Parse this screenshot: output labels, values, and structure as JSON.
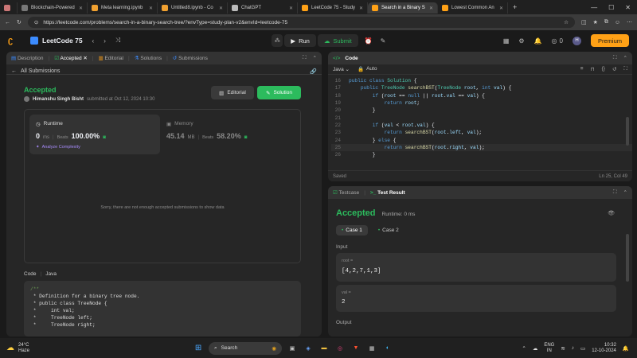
{
  "browser": {
    "tabs": [
      {
        "label": "Blockchain-Powered"
      },
      {
        "label": "Meta learning.ipynb"
      },
      {
        "label": "Untitled8.ipynb - Co"
      },
      {
        "label": "ChatGPT"
      },
      {
        "label": "LeetCode 75 - Study"
      },
      {
        "label": "Search in a Binary S"
      },
      {
        "label": "Lowest Common An"
      }
    ],
    "url": "https://leetcode.com/problems/search-in-a-binary-search-tree/?envType=study-plan-v2&envId=leetcode-75"
  },
  "topbar": {
    "title": "LeetCode 75",
    "run_label": "Run",
    "submit_label": "Submit",
    "coins": "0",
    "avatar": "H",
    "premium_label": "Premium"
  },
  "left": {
    "tabs": [
      "Description",
      "Accepted",
      "Editorial",
      "Solutions",
      "Submissions"
    ],
    "back_label": "All Submissions",
    "status": "Accepted",
    "user": "Himanshu Singh Bisht",
    "submitted_text": "submitted at Oct 12, 2024 10:30",
    "editorial_btn": "Editorial",
    "solution_btn": "Solution",
    "runtime": {
      "label": "Runtime",
      "value": "0",
      "unit": "ms",
      "beats_label": "Beats",
      "beats": "100.00%",
      "analyze": "Analyze Complexity"
    },
    "memory": {
      "label": "Memory",
      "value": "45.14",
      "unit": "MB",
      "beats_label": "Beats",
      "beats": "58.20%"
    },
    "empty_msg": "Sorry, there are not enough accepted submissions to show data",
    "code_label": "Code",
    "code_lang": "Java",
    "code_lines": [
      "/**",
      " * Definition for a binary tree node.",
      " * public class TreeNode {",
      " *     int val;",
      " *     TreeNode left;",
      " *     TreeNode right;"
    ]
  },
  "editor": {
    "title": "Code",
    "lang": "Java",
    "mode": "Auto",
    "lines": [
      {
        "n": "16",
        "t": "public class Solution {"
      },
      {
        "n": "17",
        "t": "    public TreeNode searchBST(TreeNode root, int val) {"
      },
      {
        "n": "18",
        "t": "        if (root == null || root.val == val) {"
      },
      {
        "n": "19",
        "t": "            return root;"
      },
      {
        "n": "20",
        "t": "        }"
      },
      {
        "n": "21",
        "t": ""
      },
      {
        "n": "22",
        "t": "        if (val < root.val) {"
      },
      {
        "n": "23",
        "t": "            return searchBST(root.left, val);"
      },
      {
        "n": "24",
        "t": "        } else {"
      },
      {
        "n": "25",
        "t": "            return searchBST(root.right, val);"
      },
      {
        "n": "26",
        "t": "        }"
      }
    ],
    "saved": "Saved",
    "cursor": "Ln 25, Col 49"
  },
  "testpanel": {
    "tab_testcase": "Testcase",
    "tab_result": "Test Result",
    "status": "Accepted",
    "runtime_text": "Runtime: 0 ms",
    "case1": "Case 1",
    "case2": "Case 2",
    "input_label": "Input",
    "root_label": "root =",
    "root_value": "[4,2,7,1,3]",
    "val_label": "val =",
    "val_value": "2",
    "output_label": "Output"
  },
  "taskbar": {
    "weather_temp": "24°C",
    "weather_desc": "Haze",
    "search_placeholder": "Search",
    "lang_line1": "ENG",
    "lang_line2": "IN",
    "time": "10:32",
    "date": "12-10-2024"
  }
}
